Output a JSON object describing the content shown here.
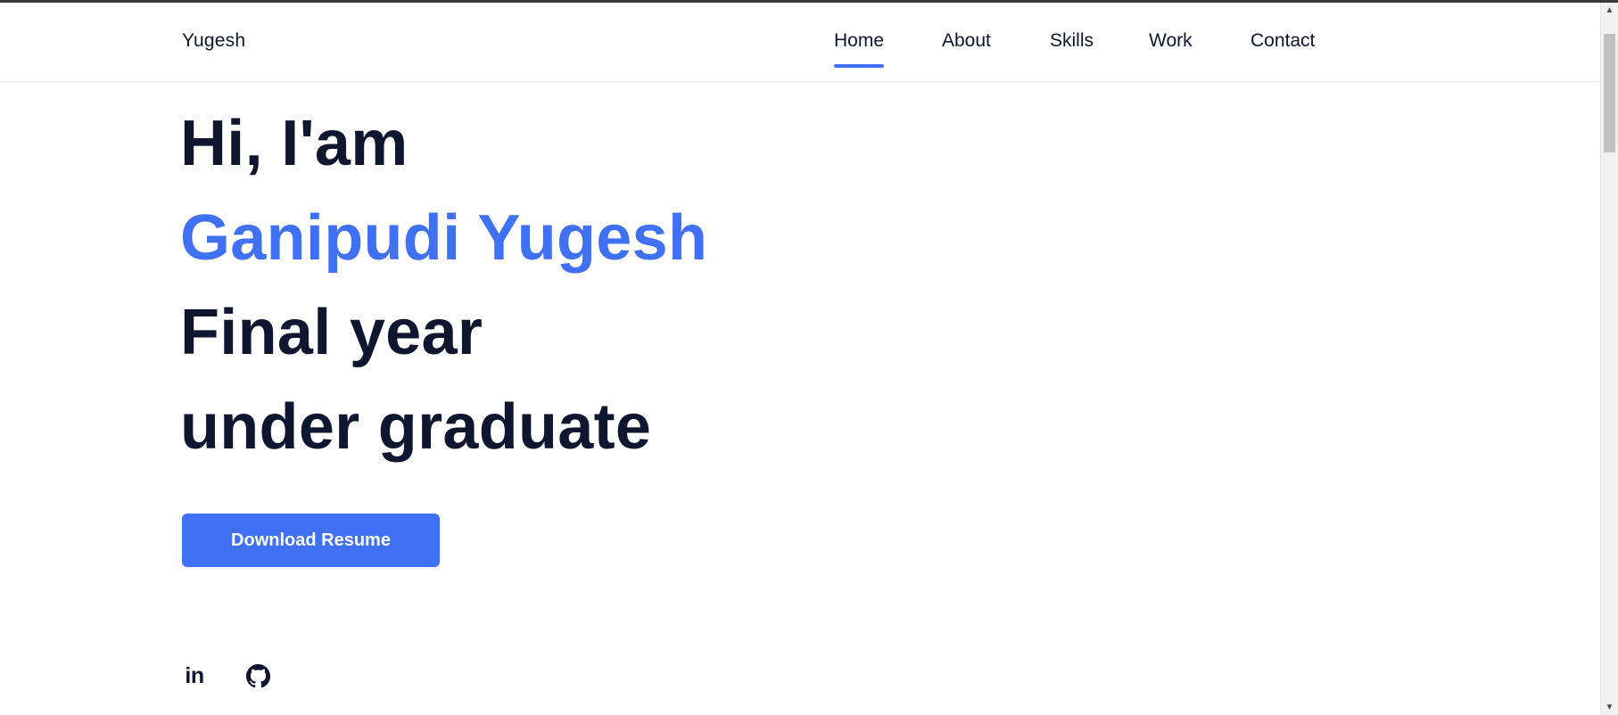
{
  "header": {
    "logo": "Yugesh",
    "nav": [
      {
        "label": "Home",
        "active": true
      },
      {
        "label": "About",
        "active": false
      },
      {
        "label": "Skills",
        "active": false
      },
      {
        "label": "Work",
        "active": false
      },
      {
        "label": "Contact",
        "active": false
      }
    ]
  },
  "hero": {
    "greeting": "Hi, I'am",
    "name": "Ganipudi Yugesh",
    "line3": "Final year",
    "line4": "under graduate"
  },
  "actions": {
    "download_resume": "Download Resume"
  },
  "social": {
    "linkedin_icon_text": "in",
    "icons": [
      "linkedin-icon",
      "github-icon"
    ]
  },
  "colors": {
    "accent": "#4070f4",
    "text_dark": "#0e1630",
    "background": "#ffffff"
  }
}
